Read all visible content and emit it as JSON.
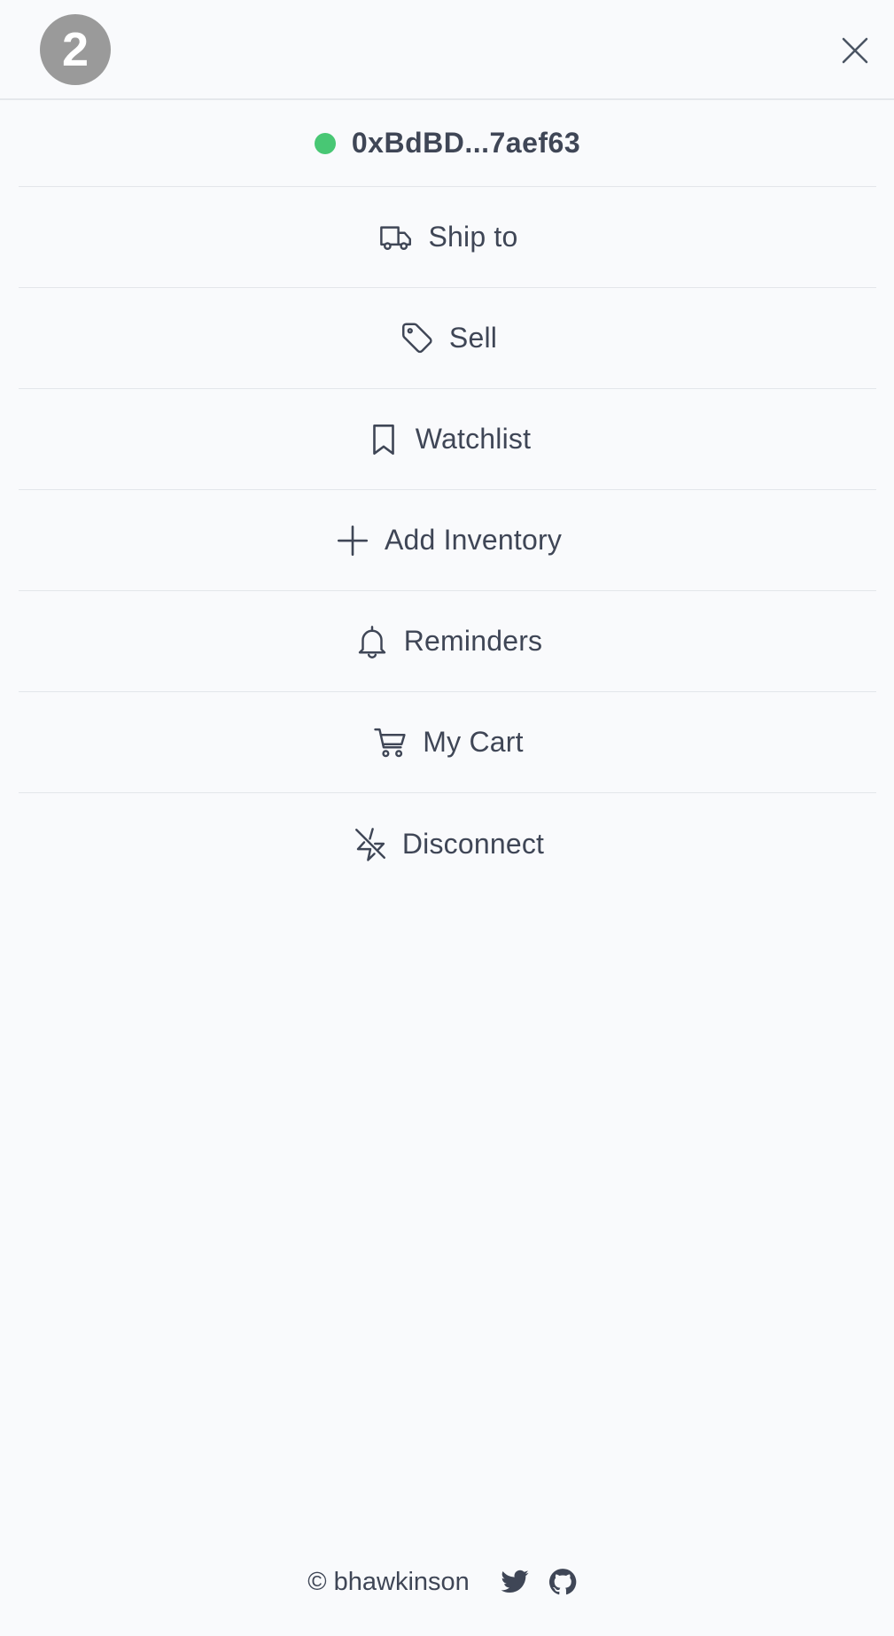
{
  "header": {
    "logo_glyph": "2",
    "logo_icon": "numbered-circle-logo",
    "close_icon": "close-icon"
  },
  "wallet": {
    "address": "0xBdBD...7aef63",
    "status_color": "#48c774"
  },
  "menu": {
    "items": [
      {
        "label": "Ship to",
        "icon": "truck-icon"
      },
      {
        "label": "Sell",
        "icon": "tag-icon"
      },
      {
        "label": "Watchlist",
        "icon": "bookmark-icon"
      },
      {
        "label": "Add Inventory",
        "icon": "plus-icon"
      },
      {
        "label": "Reminders",
        "icon": "bell-icon"
      },
      {
        "label": "My Cart",
        "icon": "cart-icon"
      },
      {
        "label": "Disconnect",
        "icon": "zap-off-icon"
      }
    ]
  },
  "footer": {
    "copyright": "© bhawkinson",
    "links": [
      {
        "icon": "twitter-icon"
      },
      {
        "icon": "github-icon"
      }
    ]
  },
  "colors": {
    "background": "#f9fafc",
    "text": "#3f4656",
    "divider": "#e3e6ea",
    "logo": "#9a9a9a"
  }
}
